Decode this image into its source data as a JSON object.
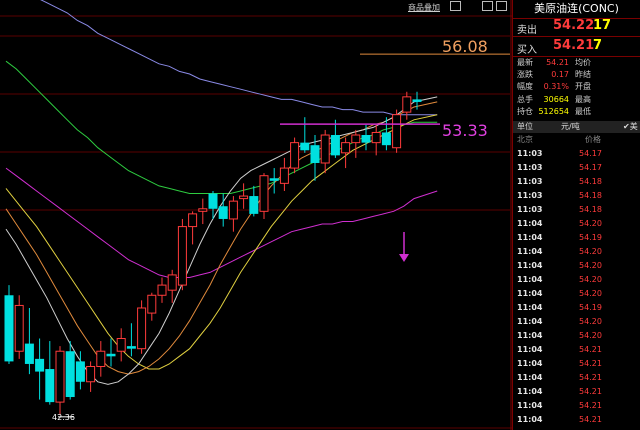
{
  "toolbar": {
    "link_label": "商品叠加",
    "window_buttons": [
      "minimize",
      "restore",
      "close"
    ]
  },
  "quote_panel": {
    "title": "美原油连(CONC)",
    "sell_label": "卖出",
    "sell_price": "54.22",
    "sell_volume": "17",
    "buy_label": "买入",
    "buy_price": "54.21",
    "buy_volume": "7",
    "stats": [
      {
        "label": "最新",
        "value": "54.21",
        "label2": "均价",
        "color": "#ff3b3b"
      },
      {
        "label": "涨跌",
        "value": "0.17",
        "label2": "昨结",
        "color": "#ff3b3b"
      },
      {
        "label": "幅度",
        "value": "0.31%",
        "label2": "开盘",
        "color": "#ff3b3b"
      },
      {
        "label": "总手",
        "value": "30664",
        "label2": "最高",
        "color": "#ffff00"
      },
      {
        "label": "持仓",
        "value": "512654",
        "label2": "最低",
        "color": "#ffff00"
      }
    ],
    "unit_label": "单位",
    "unit_value": "元/吨",
    "unit_check": "✔美",
    "tick_header_time": "北京",
    "tick_header_price": "价格",
    "ticks": [
      {
        "time": "11:03",
        "price": "54.17"
      },
      {
        "time": "11:03",
        "price": "54.17"
      },
      {
        "time": "11:03",
        "price": "54.18"
      },
      {
        "time": "11:03",
        "price": "54.18"
      },
      {
        "time": "11:03",
        "price": "54.18"
      },
      {
        "time": "11:04",
        "price": "54.20"
      },
      {
        "time": "11:04",
        "price": "54.19"
      },
      {
        "time": "11:04",
        "price": "54.20"
      },
      {
        "time": "11:04",
        "price": "54.20"
      },
      {
        "time": "11:04",
        "price": "54.20"
      },
      {
        "time": "11:04",
        "price": "54.20"
      },
      {
        "time": "11:04",
        "price": "54.19"
      },
      {
        "time": "11:04",
        "price": "54.20"
      },
      {
        "time": "11:04",
        "price": "54.20"
      },
      {
        "time": "11:04",
        "price": "54.21"
      },
      {
        "time": "11:04",
        "price": "54.21"
      },
      {
        "time": "11:04",
        "price": "54.21"
      },
      {
        "time": "11:04",
        "price": "54.21"
      },
      {
        "time": "11:04",
        "price": "54.21"
      },
      {
        "time": "11:04",
        "price": "54.21"
      }
    ]
  },
  "chart_data": {
    "type": "candlestick",
    "title": "",
    "ylim": [
      41.5,
      57.5
    ],
    "candles": [
      {
        "o": 46.6,
        "h": 47.0,
        "l": 43.9,
        "c": 44.0
      },
      {
        "o": 44.4,
        "h": 46.6,
        "l": 44.1,
        "c": 46.2
      },
      {
        "o": 44.7,
        "h": 46.1,
        "l": 43.5,
        "c": 43.9
      },
      {
        "o": 44.1,
        "h": 44.9,
        "l": 42.5,
        "c": 43.6
      },
      {
        "o": 43.7,
        "h": 44.8,
        "l": 42.3,
        "c": 42.4
      },
      {
        "o": 42.4,
        "h": 44.6,
        "l": 41.9,
        "c": 44.4
      },
      {
        "o": 44.4,
        "h": 44.8,
        "l": 42.5,
        "c": 42.6
      },
      {
        "o": 44.0,
        "h": 44.4,
        "l": 42.9,
        "c": 43.2
      },
      {
        "o": 43.2,
        "h": 44.0,
        "l": 42.8,
        "c": 43.8
      },
      {
        "o": 43.8,
        "h": 44.8,
        "l": 43.4,
        "c": 44.4
      },
      {
        "o": 44.3,
        "h": 44.9,
        "l": 43.8,
        "c": 44.2
      },
      {
        "o": 44.4,
        "h": 45.3,
        "l": 44.0,
        "c": 44.9
      },
      {
        "o": 44.6,
        "h": 45.5,
        "l": 44.2,
        "c": 44.5
      },
      {
        "o": 44.5,
        "h": 46.4,
        "l": 44.3,
        "c": 46.1
      },
      {
        "o": 45.9,
        "h": 46.7,
        "l": 45.6,
        "c": 46.6
      },
      {
        "o": 46.6,
        "h": 47.3,
        "l": 46.3,
        "c": 47.0
      },
      {
        "o": 46.8,
        "h": 47.6,
        "l": 46.3,
        "c": 47.4
      },
      {
        "o": 47.0,
        "h": 49.6,
        "l": 46.8,
        "c": 49.3
      },
      {
        "o": 49.3,
        "h": 49.9,
        "l": 48.6,
        "c": 49.8
      },
      {
        "o": 49.9,
        "h": 50.4,
        "l": 49.4,
        "c": 50.0
      },
      {
        "o": 50.6,
        "h": 50.7,
        "l": 49.6,
        "c": 50.0
      },
      {
        "o": 50.1,
        "h": 50.6,
        "l": 49.3,
        "c": 49.6
      },
      {
        "o": 49.6,
        "h": 50.5,
        "l": 49.1,
        "c": 50.3
      },
      {
        "o": 50.4,
        "h": 51.0,
        "l": 50.0,
        "c": 50.5
      },
      {
        "o": 50.5,
        "h": 50.9,
        "l": 49.7,
        "c": 49.8
      },
      {
        "o": 49.9,
        "h": 51.4,
        "l": 49.6,
        "c": 51.3
      },
      {
        "o": 51.2,
        "h": 51.6,
        "l": 50.6,
        "c": 51.1
      },
      {
        "o": 51.0,
        "h": 52.0,
        "l": 50.7,
        "c": 51.6
      },
      {
        "o": 51.6,
        "h": 52.8,
        "l": 51.4,
        "c": 52.6
      },
      {
        "o": 52.6,
        "h": 53.6,
        "l": 52.2,
        "c": 52.3
      },
      {
        "o": 52.5,
        "h": 52.9,
        "l": 51.1,
        "c": 51.8
      },
      {
        "o": 51.8,
        "h": 53.1,
        "l": 51.4,
        "c": 52.9
      },
      {
        "o": 52.9,
        "h": 53.5,
        "l": 52.0,
        "c": 52.1
      },
      {
        "o": 52.2,
        "h": 52.8,
        "l": 51.6,
        "c": 52.6
      },
      {
        "o": 52.6,
        "h": 53.1,
        "l": 52.0,
        "c": 52.9
      },
      {
        "o": 52.9,
        "h": 53.3,
        "l": 52.3,
        "c": 52.6
      },
      {
        "o": 52.6,
        "h": 53.3,
        "l": 52.1,
        "c": 53.0
      },
      {
        "o": 53.0,
        "h": 53.6,
        "l": 52.3,
        "c": 52.5
      },
      {
        "o": 52.4,
        "h": 53.9,
        "l": 52.2,
        "c": 53.7
      },
      {
        "o": 53.8,
        "h": 54.6,
        "l": 53.5,
        "c": 54.4
      },
      {
        "o": 54.3,
        "h": 54.6,
        "l": 53.9,
        "c": 54.2
      }
    ],
    "ma_lines": [
      {
        "color": "#8a8ae6",
        "values": [
          59.5,
          59.0,
          58.6,
          58.3,
          58.1,
          57.9,
          57.7,
          57.4,
          57.2,
          56.9,
          56.7,
          56.5,
          56.3,
          56.1,
          55.9,
          55.7,
          55.6,
          55.4,
          55.3,
          55.1,
          55.0,
          54.9,
          54.8,
          54.7,
          54.6,
          54.5,
          54.4,
          54.3,
          54.3,
          54.2,
          54.1,
          54.0,
          54.0,
          53.9,
          53.9,
          53.8,
          53.8,
          53.8,
          53.7,
          53.7,
          53.7,
          53.7
        ]
      },
      {
        "color": "#2ecc40",
        "values": [
          55.8,
          55.5,
          55.1,
          54.7,
          54.3,
          53.9,
          53.5,
          53.1,
          52.8,
          52.4,
          52.1,
          51.8,
          51.5,
          51.3,
          51.1,
          50.9,
          50.8,
          50.7,
          50.6,
          50.6,
          50.6,
          50.6,
          50.6,
          50.7,
          50.8,
          50.9,
          51.0,
          51.2,
          51.4,
          51.6,
          51.8,
          52.0,
          52.2,
          52.4,
          52.6,
          52.8,
          52.9,
          53.1,
          53.2,
          53.3,
          53.4,
          53.4
        ]
      },
      {
        "color": "#d02fd0",
        "values": [
          51.6,
          51.3,
          51.0,
          50.7,
          50.4,
          50.1,
          49.8,
          49.5,
          49.2,
          48.9,
          48.6,
          48.3,
          48.0,
          47.8,
          47.6,
          47.4,
          47.3,
          47.3,
          47.3,
          47.4,
          47.5,
          47.7,
          47.9,
          48.1,
          48.3,
          48.5,
          48.7,
          48.9,
          49.1,
          49.2,
          49.3,
          49.4,
          49.4,
          49.5,
          49.5,
          49.6,
          49.7,
          49.8,
          49.9,
          50.1,
          50.4,
          50.7
        ]
      },
      {
        "color": "#e0d040",
        "values": [
          50.8,
          50.3,
          49.8,
          49.3,
          48.7,
          48.1,
          47.5,
          46.9,
          46.3,
          45.7,
          45.1,
          44.6,
          44.2,
          43.9,
          43.7,
          43.7,
          43.9,
          44.2,
          44.5,
          45.0,
          45.5,
          46.1,
          46.8,
          47.5,
          48.1,
          48.7,
          49.3,
          49.8,
          50.3,
          50.7,
          51.1,
          51.4,
          51.7,
          52.0,
          52.3,
          52.5,
          52.7,
          52.9,
          53.1,
          53.3,
          53.5,
          53.7
        ]
      },
      {
        "color": "#e08a3c",
        "values": [
          50.0,
          49.4,
          48.8,
          48.2,
          47.5,
          46.8,
          46.1,
          45.4,
          44.8,
          44.2,
          43.8,
          43.6,
          43.5,
          43.6,
          43.8,
          44.1,
          44.5,
          45.0,
          45.6,
          46.3,
          47.0,
          47.8,
          48.5,
          49.2,
          49.8,
          50.4,
          50.9,
          51.3,
          51.7,
          52.0,
          52.2,
          52.4,
          52.6,
          52.8,
          53.0,
          53.1,
          53.3,
          53.4,
          53.6,
          53.8,
          54.0,
          54.2
        ]
      },
      {
        "color": "#cfcfcf",
        "values": [
          49.2,
          48.6,
          47.9,
          47.2,
          46.5,
          45.7,
          44.9,
          44.2,
          43.6,
          43.2,
          43.1,
          43.2,
          43.5,
          43.9,
          44.5,
          45.1,
          45.9,
          46.8,
          47.7,
          48.6,
          49.4,
          50.1,
          50.7,
          51.2,
          51.5,
          51.7,
          51.9,
          52.1,
          52.3,
          52.5,
          52.6,
          52.7,
          52.8,
          52.9,
          53.0,
          53.1,
          53.2,
          53.4,
          53.6,
          53.9,
          54.2,
          54.4
        ]
      }
    ],
    "low_label": "42.36",
    "high_price": 56.08,
    "high_label": "56.08",
    "level_price": 53.33,
    "level_label": "53.33"
  }
}
